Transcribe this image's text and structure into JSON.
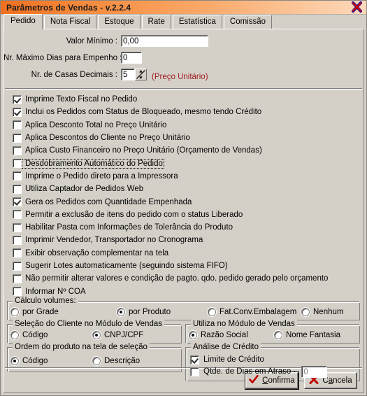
{
  "window": {
    "title": "Parâmetros de Vendas - v.2.2.4",
    "close_icon": "close-x-icon"
  },
  "tabs": [
    {
      "label": "Pedido",
      "active": true
    },
    {
      "label": "Nota Fiscal",
      "active": false
    },
    {
      "label": "Estoque",
      "active": false
    },
    {
      "label": "Rate",
      "active": false
    },
    {
      "label": "Estatística",
      "active": false
    },
    {
      "label": "Comissão",
      "active": false
    }
  ],
  "fields": {
    "valor_minimo": {
      "label": "Valor Mínimo :",
      "value": "0,00"
    },
    "dias_empenho": {
      "label": "Nr. Máximo Dias para Empenho :",
      "value": "0"
    },
    "casas_decimais": {
      "label": "Nr. de Casas Decimais :",
      "value": "5",
      "note": "(Preço Unitário)"
    }
  },
  "checkboxes": [
    {
      "label": "Imprime Texto Fiscal no Pedido",
      "checked": true,
      "focused": false
    },
    {
      "label": "Inclui os Pedidos com Status de Bloqueado, mesmo tendo Crédito",
      "checked": true,
      "focused": false
    },
    {
      "label": "Aplica Desconto Total no Preço Unitário",
      "checked": false,
      "focused": false
    },
    {
      "label": "Aplica Descontos do Cliente no Preço Unitário",
      "checked": false,
      "focused": false
    },
    {
      "label": "Aplica Custo Financeiro no Preço Unitário (Orçamento de Vendas)",
      "checked": false,
      "focused": false
    },
    {
      "label": "Desdobramento Automático do Pedido",
      "checked": false,
      "focused": true
    },
    {
      "label": "Imprime o Pedido direto para a Impressora",
      "checked": false,
      "focused": false
    },
    {
      "label": "Utiliza Captador de Pedidos Web",
      "checked": false,
      "focused": false
    },
    {
      "label": "Gera os Pedidos com Quantidade Empenhada",
      "checked": true,
      "focused": false
    },
    {
      "label": "Permitir a exclusão de itens do pedido com o status Liberado",
      "checked": false,
      "focused": false
    },
    {
      "label": "Habilitar Pasta com Informações de Tolerância do Produto",
      "checked": false,
      "focused": false
    },
    {
      "label": "Imprimir Vendedor, Transportador no Cronograma",
      "checked": false,
      "focused": false
    },
    {
      "label": "Exibir observação complementar na tela",
      "checked": false,
      "focused": false
    },
    {
      "label": "Sugerir Lotes automaticamente (seguindo sistema FIFO)",
      "checked": false,
      "focused": false
    },
    {
      "label": "Não permitir alterar valores e condição de pagto. qdo. pedido gerado pelo orçamento",
      "checked": false,
      "focused": false
    },
    {
      "label": "Informar Nº COA",
      "checked": false,
      "focused": false
    }
  ],
  "groups": {
    "calculo_volumes": {
      "title": "Cálculo volumes:",
      "options": [
        {
          "label": "por Grade",
          "selected": false
        },
        {
          "label": "por Produto",
          "selected": true
        },
        {
          "label": "Fat.Conv.Embalagem",
          "selected": false
        },
        {
          "label": "Nenhum",
          "selected": false
        }
      ]
    },
    "selecao_cliente": {
      "title": "Seleção do Cliente no Módulo de Vendas",
      "options": [
        {
          "label": "Código",
          "selected": false
        },
        {
          "label": "CNPJ/CPF",
          "selected": true
        }
      ]
    },
    "utiliza_modulo": {
      "title": "Utiliza no Módulo de Vendas",
      "options": [
        {
          "label": "Razão Social",
          "selected": true
        },
        {
          "label": "Nome Fantasia",
          "selected": false
        }
      ]
    },
    "ordem_produto": {
      "title": "Ordem do produto na tela de seleção",
      "options": [
        {
          "label": "Código",
          "selected": true
        },
        {
          "label": "Descrição",
          "selected": false
        }
      ]
    },
    "analise_credito": {
      "title": "Análise de Crédito",
      "items": [
        {
          "label": "Limite de Crédito",
          "checked": true
        },
        {
          "label": "Qtde. de Dias em Atraso ·",
          "checked": false
        }
      ],
      "dias_atraso_value": "0"
    }
  },
  "footer": {
    "confirm": {
      "label": "Confirma",
      "accel": "C",
      "icon": "check-mark-icon"
    },
    "cancel": {
      "label": "Cancela",
      "accel": "a",
      "icon": "x-mark-icon"
    }
  },
  "colors": {
    "title_start": "#f07020",
    "title_end": "#fdd9bb",
    "face": "#d4d0c8",
    "note_text": "#a02020",
    "confirm_icon": "#c00000",
    "cancel_icon": "#c00000"
  }
}
